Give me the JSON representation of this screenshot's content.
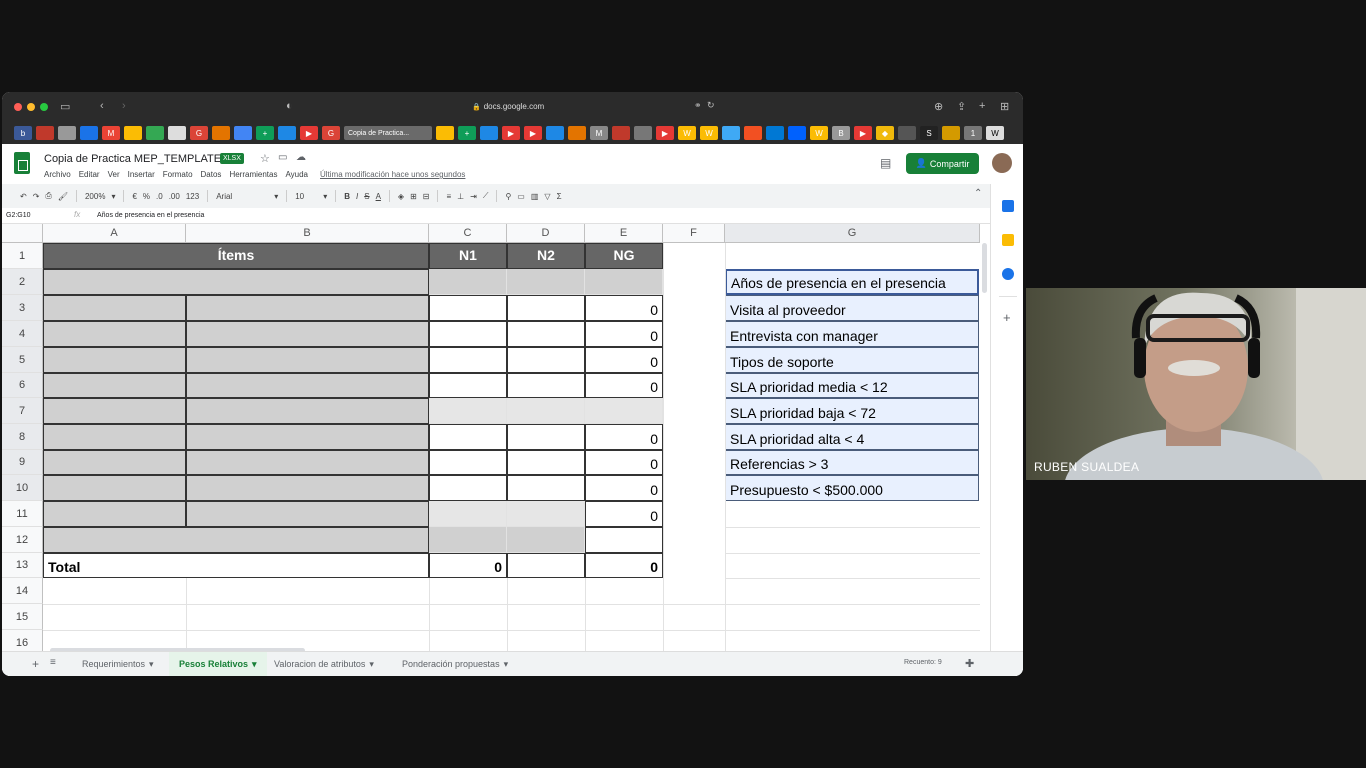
{
  "browser": {
    "url": "docs.google.com",
    "active_tab": "Copia de Practica..."
  },
  "sheets": {
    "title": "Copia de Practica MEP_TEMPLATE",
    "badge": "XLSX",
    "menu": [
      "Archivo",
      "Editar",
      "Ver",
      "Insertar",
      "Formato",
      "Datos",
      "Herramientas",
      "Ayuda"
    ],
    "last_edit": "Última modificación hace unos segundos",
    "share_label": "Compartir",
    "toolbar": {
      "zoom": "200%",
      "currency": "€",
      "percent": "%",
      "dec_less": ".0",
      "dec_more": ".00",
      "format": "123",
      "font": "Arial",
      "size": "10"
    },
    "cell_ref": "G2:G10",
    "formula": "Años de presencia en el presencia"
  },
  "grid": {
    "columns": [
      "A",
      "B",
      "C",
      "D",
      "E",
      "F",
      "G"
    ],
    "rows": [
      "1",
      "2",
      "3",
      "4",
      "5",
      "6",
      "7",
      "8",
      "9",
      "10",
      "11",
      "12",
      "13",
      "14",
      "15",
      "16"
    ],
    "header": {
      "items": "Ítems",
      "n1": "N1",
      "n2": "N2",
      "ng": "NG"
    },
    "ng_values": [
      "",
      "0",
      "0",
      "0",
      "0",
      "",
      "0",
      "0",
      "0",
      "0",
      ""
    ],
    "total_label": "Total",
    "total_n1": "0",
    "total_ng": "0",
    "criteria": [
      "Años de presencia en el presencia",
      "Visita al proveedor",
      "Entrevista con manager",
      "Tipos de soporte",
      "SLA prioridad media < 12",
      "SLA prioridad baja < 72",
      "SLA prioridad alta < 4",
      "Referencias > 3",
      "Presupuesto < $500.000"
    ]
  },
  "tabs": [
    "Requerimientos",
    "Pesos Relativos",
    "Valoracion de atributos",
    "Ponderación propuestas"
  ],
  "status": "Recuento: 9",
  "webcam": {
    "name": "RUBEN SUALDEA"
  }
}
